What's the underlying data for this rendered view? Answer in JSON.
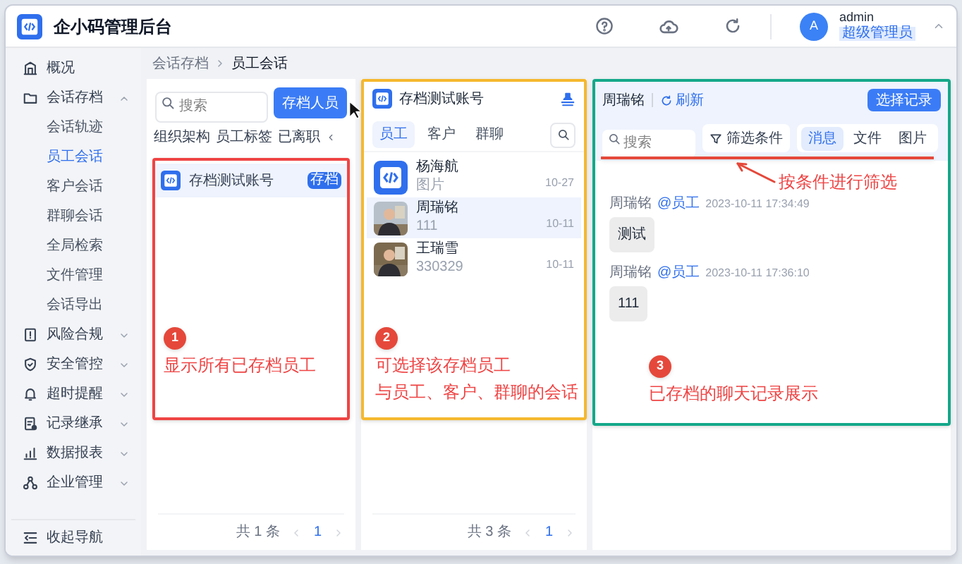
{
  "header": {
    "title": "企小码管理后台",
    "user": {
      "initial": "A",
      "name": "admin",
      "role": "超级管理员"
    }
  },
  "sidebar": {
    "items": [
      {
        "kind": "link",
        "label": "概况"
      },
      {
        "kind": "group",
        "label": "会话存档",
        "expanded": true,
        "children": [
          {
            "label": "会话轨迹",
            "selected": false
          },
          {
            "label": "员工会话",
            "selected": true
          },
          {
            "label": "客户会话",
            "selected": false
          },
          {
            "label": "群聊会话",
            "selected": false
          },
          {
            "label": "全局检索",
            "selected": false
          },
          {
            "label": "文件管理",
            "selected": false
          },
          {
            "label": "会话导出",
            "selected": false
          }
        ]
      },
      {
        "kind": "group",
        "label": "风险合规",
        "expanded": false
      },
      {
        "kind": "group",
        "label": "安全管控",
        "expanded": false
      },
      {
        "kind": "group",
        "label": "超时提醒",
        "expanded": false
      },
      {
        "kind": "group",
        "label": "记录继承",
        "expanded": false
      },
      {
        "kind": "group",
        "label": "数据报表",
        "expanded": false
      },
      {
        "kind": "group",
        "label": "企业管理",
        "expanded": false
      }
    ],
    "collapse": "收起导航"
  },
  "breadcrumb": [
    "会话存档",
    "员工会话"
  ],
  "staff_panel": {
    "search": {
      "placeholder": "搜索"
    },
    "button": "存档人员",
    "tabs": [
      "组织架构",
      "员工标签",
      "已离职"
    ],
    "items": [
      {
        "name": "存档测试账号",
        "badge": "存档",
        "selected": true
      }
    ],
    "pagination": {
      "total": "共 1 条",
      "page": "1"
    }
  },
  "contact_panel": {
    "account": "存档测试账号",
    "tabs": [
      {
        "label": "员工",
        "selected": true
      },
      {
        "label": "客户",
        "selected": false
      },
      {
        "label": "群聊",
        "selected": false
      }
    ],
    "contacts": [
      {
        "kind": "logo",
        "name": "杨海航",
        "preview": "图片",
        "date": "10-27",
        "selected": false
      },
      {
        "kind": "picture",
        "name": "周瑞铭",
        "preview": "111",
        "date": "10-11",
        "selected": true
      },
      {
        "kind": "picture",
        "name": "王瑞雪",
        "preview": "330329",
        "date": "10-11",
        "selected": false
      }
    ],
    "pagination": {
      "total": "共 3 条",
      "page": "1"
    }
  },
  "chat_panel": {
    "contact": "周瑞铭",
    "refresh": "刷新",
    "button": "选择记录",
    "search": {
      "placeholder": "搜索"
    },
    "filter": "筛选条件",
    "tabs": [
      {
        "label": "消息",
        "selected": true
      },
      {
        "label": "文件",
        "selected": false
      },
      {
        "label": "图片",
        "selected": false
      }
    ],
    "messages": [
      {
        "sender": "周瑞铭",
        "tag": "@员工",
        "time": "2023-10-11 17:34:49",
        "text": "测试"
      },
      {
        "sender": "周瑞铭",
        "tag": "@员工",
        "time": "2023-10-11 17:36:10",
        "text": "111"
      }
    ],
    "filter_callout": "按条件进行筛选"
  },
  "annotations": [
    {
      "number": "1",
      "lines": [
        "显示所有已存档员工"
      ],
      "color": "#ef4444"
    },
    {
      "number": "2",
      "lines": [
        "可选择该存档员工",
        "与员工、客户、群聊的会话"
      ],
      "color": "#f5b82e"
    },
    {
      "number": "3",
      "lines": [
        "已存档的聊天记录展示"
      ],
      "color": "#14a88a"
    }
  ]
}
